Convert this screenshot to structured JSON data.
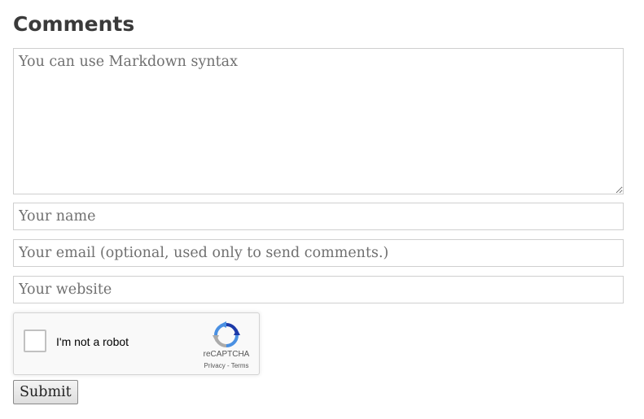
{
  "comments": {
    "heading": "Comments",
    "body_placeholder": "You can use Markdown syntax",
    "name_placeholder": "Your name",
    "email_placeholder": "Your email (optional, used only to send comments.)",
    "website_placeholder": "Your website",
    "submit_label": "Submit"
  },
  "captcha": {
    "label": "I'm not a robot",
    "brand": "reCAPTCHA",
    "privacy_link": "Privacy",
    "separator": " - ",
    "terms_link": "Terms",
    "checked": false,
    "logo_icon": "recaptcha-logo-icon"
  }
}
